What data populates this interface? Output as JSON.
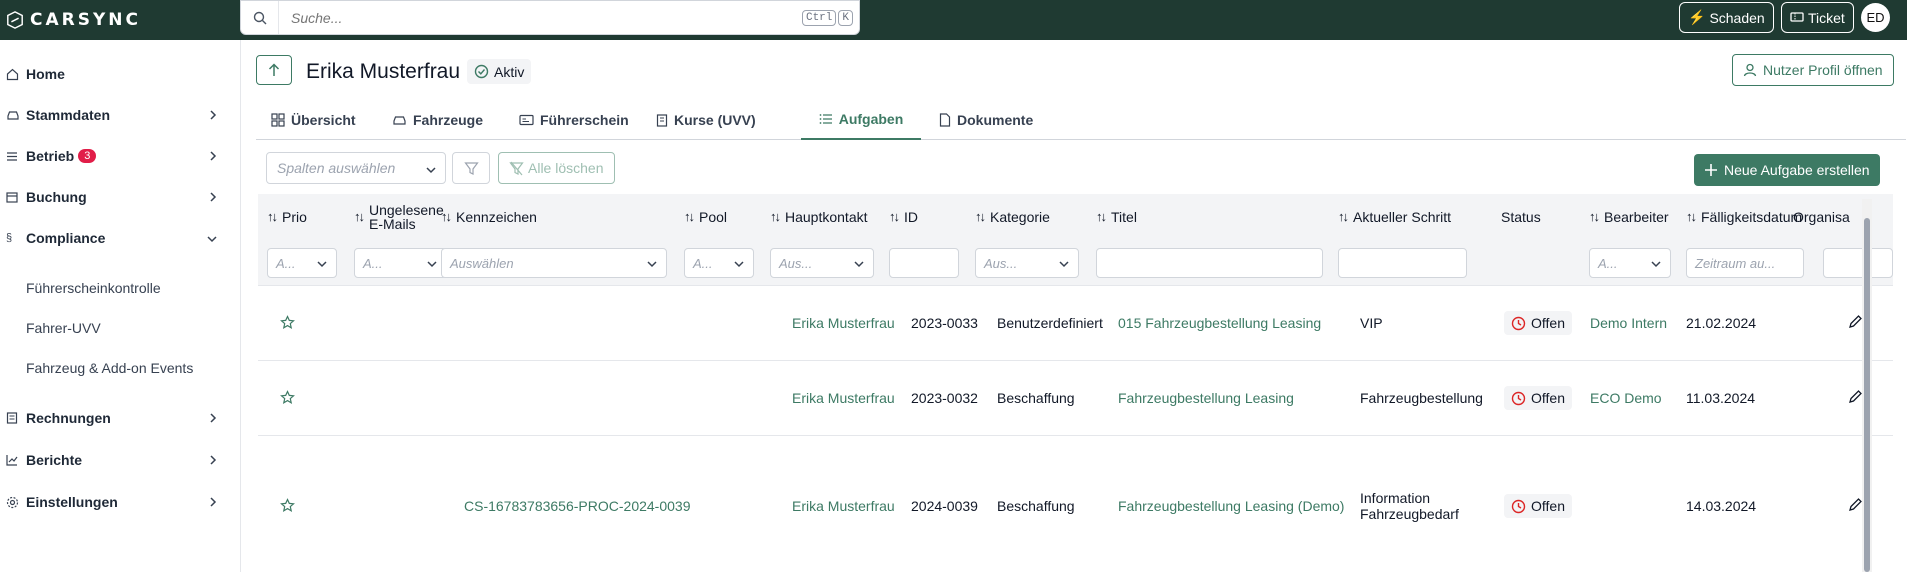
{
  "app": {
    "logo_text": "CARSYNC"
  },
  "topbar": {
    "search_placeholder": "Suche...",
    "kbd_ctrl": "Ctrl",
    "kbd_k": "K",
    "schaden_label": "Schaden",
    "ticket_label": "Ticket",
    "avatar_initials": "ED"
  },
  "sidebar": {
    "home": "Home",
    "stammdaten": "Stammdaten",
    "betrieb": "Betrieb",
    "betrieb_badge": "3",
    "buchung": "Buchung",
    "compliance": "Compliance",
    "compliance_sub": [
      "Führerscheinkontrolle",
      "Fahrer-UVV",
      "Fahrzeug & Add-on Events"
    ],
    "rechnungen": "Rechnungen",
    "berichte": "Berichte",
    "einstellungen": "Einstellungen"
  },
  "header": {
    "title": "Erika Musterfrau",
    "status": "Aktiv",
    "profile_button": "Nutzer Profil öffnen"
  },
  "tabs": [
    "Übersicht",
    "Fahrzeuge",
    "Führerschein",
    "Kurse (UVV)",
    "Aufgaben",
    "Dokumente"
  ],
  "active_tab": "Aufgaben",
  "toolbar": {
    "columns_placeholder": "Spalten auswählen",
    "clear_label": "Alle löschen",
    "new_task_label": "Neue Aufgabe erstellen"
  },
  "table": {
    "columns": {
      "prio": "Prio",
      "unread_1": "Ungelesene",
      "unread_2": "E-Mails",
      "kennzeichen": "Kennzeichen",
      "pool": "Pool",
      "hauptkontakt": "Hauptkontakt",
      "id": "ID",
      "kategorie": "Kategorie",
      "titel": "Titel",
      "schritt": "Aktueller Schritt",
      "status": "Status",
      "bearbeiter": "Bearbeiter",
      "faellig": "Fälligkeitsdatum",
      "organisation": "Organisa"
    },
    "filters": {
      "prio": "A...",
      "unread": "A...",
      "kennzeichen": "Auswählen",
      "pool": "A...",
      "hauptkontakt": "Aus...",
      "kategorie": "Aus...",
      "bearbeiter": "A...",
      "faellig": "Zeitraum au..."
    },
    "rows": [
      {
        "kennzeichen": "",
        "hauptkontakt": "Erika Musterfrau",
        "id": "2023-0033",
        "kategorie": "Benutzerdefiniert",
        "titel": "015 Fahrzeugbestellung Leasing",
        "schritt_1": "VIP",
        "schritt_2": "",
        "status": "Offen",
        "bearbeiter": "Demo Intern",
        "faellig": "21.02.2024"
      },
      {
        "kennzeichen": "",
        "hauptkontakt": "Erika Musterfrau",
        "id": "2023-0032",
        "kategorie": "Beschaffung",
        "titel": "Fahrzeugbestellung Leasing",
        "schritt_1": "Fahrzeugbestellung",
        "schritt_2": "",
        "status": "Offen",
        "bearbeiter": "ECO Demo",
        "faellig": "11.03.2024"
      },
      {
        "kennzeichen": "CS-16783783656-PROC-2024-0039",
        "hauptkontakt": "Erika Musterfrau",
        "id": "2024-0039",
        "kategorie": "Beschaffung",
        "titel": "Fahrzeugbestellung Leasing (Demo)",
        "schritt_1": "Information",
        "schritt_2": "Fahrzeugbedarf",
        "status": "Offen",
        "bearbeiter": "",
        "faellig": "14.03.2024"
      }
    ]
  },
  "colors": {
    "brand_dark": "#1f3a32",
    "accent": "#3d7a64",
    "badge": "#e11d48",
    "status_red": "#dc2626"
  }
}
